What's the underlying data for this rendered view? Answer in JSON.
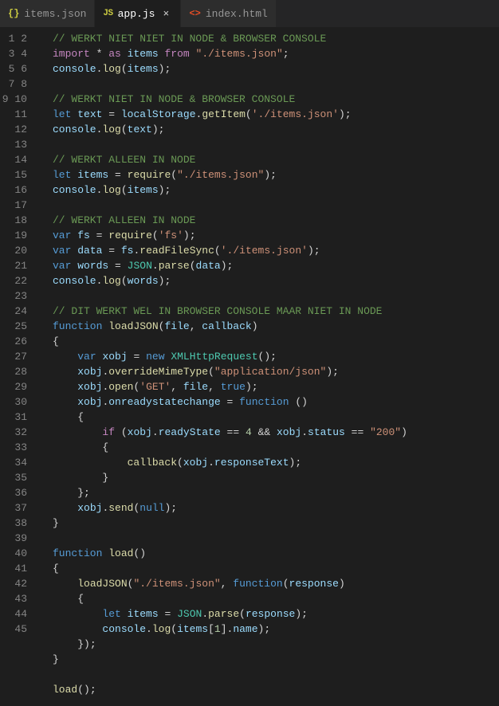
{
  "tabs": [
    {
      "icon": "{}",
      "label": "items.json"
    },
    {
      "icon": "JS",
      "label": "app.js",
      "active": true
    },
    {
      "icon": "<>",
      "label": "index.html"
    }
  ],
  "lineCount": 45,
  "code": {
    "l1": "// WERKT NIET NIET IN NODE & BROWSER CONSOLE",
    "l2a": "import",
    "l2b": "*",
    "l2c": "as",
    "l2d": "items",
    "l2e": "from",
    "l2f": "\"./items.json\"",
    "l3a": "console",
    "l3b": "log",
    "l3c": "items",
    "l5": "// WERKT NIET IN NODE & BROWSER CONSOLE",
    "l6a": "let",
    "l6b": "text",
    "l6c": "localStorage",
    "l6d": "getItem",
    "l6e": "'./items.json'",
    "l7a": "console",
    "l7b": "log",
    "l7c": "text",
    "l9": "// WERKT ALLEEN IN NODE",
    "l10a": "let",
    "l10b": "items",
    "l10c": "require",
    "l10d": "\"./items.json\"",
    "l11a": "console",
    "l11b": "log",
    "l11c": "items",
    "l13": "// WERKT ALLEEN IN NODE",
    "l14a": "var",
    "l14b": "fs",
    "l14c": "require",
    "l14d": "'fs'",
    "l15a": "var",
    "l15b": "data",
    "l15c": "fs",
    "l15d": "readFileSync",
    "l15e": "'./items.json'",
    "l16a": "var",
    "l16b": "words",
    "l16c": "JSON",
    "l16d": "parse",
    "l16e": "data",
    "l17a": "console",
    "l17b": "log",
    "l17c": "words",
    "l19": "// DIT WERKT WEL IN BROWSER CONSOLE MAAR NIET IN NODE",
    "l20a": "function",
    "l20b": "loadJSON",
    "l20c": "file",
    "l20d": "callback",
    "l22a": "var",
    "l22b": "xobj",
    "l22c": "new",
    "l22d": "XMLHttpRequest",
    "l23a": "xobj",
    "l23b": "overrideMimeType",
    "l23c": "\"application/json\"",
    "l24a": "xobj",
    "l24b": "open",
    "l24c": "'GET'",
    "l24d": "file",
    "l24e": "true",
    "l25a": "xobj",
    "l25b": "onreadystatechange",
    "l25c": "function",
    "l27a": "if",
    "l27b": "xobj",
    "l27c": "readyState",
    "l27d": "4",
    "l27e": "xobj",
    "l27f": "status",
    "l27g": "\"200\"",
    "l29a": "callback",
    "l29b": "xobj",
    "l29c": "responseText",
    "l32a": "xobj",
    "l32b": "send",
    "l32c": "null",
    "l35a": "function",
    "l35b": "load",
    "l37a": "loadJSON",
    "l37b": "\"./items.json\"",
    "l37c": "function",
    "l37d": "response",
    "l39a": "let",
    "l39b": "items",
    "l39c": "JSON",
    "l39d": "parse",
    "l39e": "response",
    "l40a": "console",
    "l40b": "log",
    "l40c": "items",
    "l40d": "1",
    "l40e": "name",
    "l44a": "load"
  }
}
